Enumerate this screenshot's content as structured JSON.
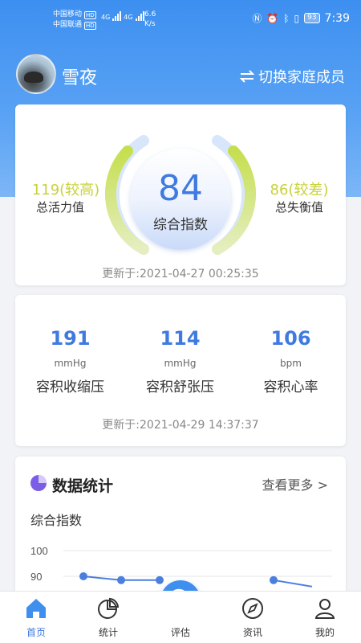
{
  "status_bar": {
    "carrier1": "中国移动",
    "carrier2": "中国联通",
    "hd": "HD",
    "net1": "4G",
    "net2": "4G",
    "speed_value": "6.6",
    "speed_unit": "K/s",
    "battery": "93",
    "time": "7:39"
  },
  "header": {
    "user_name": "雪夜",
    "switch_label": "切换家庭成员"
  },
  "index_card": {
    "score": "84",
    "score_label": "综合指数",
    "left_value": "119(较高)",
    "left_label": "总活力值",
    "right_value": "86(较差)",
    "right_label": "总失衡值",
    "updated": "更新于:2021-04-27 00:25:35"
  },
  "bp_card": {
    "items": [
      {
        "value": "191",
        "unit": "mmHg",
        "label": "容积收缩压"
      },
      {
        "value": "114",
        "unit": "mmHg",
        "label": "容积舒张压"
      },
      {
        "value": "106",
        "unit": "bpm",
        "label": "容积心率"
      }
    ],
    "updated": "更新于:2021-04-29 14:37:37"
  },
  "stats_card": {
    "title": "数据统计",
    "see_more": "查看更多 >",
    "chart_title": "综合指数"
  },
  "chart_data": {
    "type": "line",
    "title": "综合指数",
    "y_ticks": [
      "100",
      "90"
    ],
    "ylim": [
      80,
      100
    ],
    "series": [
      {
        "values": [
          90,
          88.5,
          88.5,
          null,
          null,
          88.5,
          86
        ]
      }
    ],
    "grid": true,
    "colors": {
      "line": "#4a7fde",
      "grid": "#e6e6e6"
    }
  },
  "bottom_nav": {
    "items": [
      {
        "label": "首页",
        "icon": "home-icon",
        "active": true
      },
      {
        "label": "统计",
        "icon": "pie-chart-icon",
        "active": false
      },
      {
        "label": "评估",
        "icon": "pulse-search-icon",
        "active": false
      },
      {
        "label": "资讯",
        "icon": "compass-icon",
        "active": false
      },
      {
        "label": "我的",
        "icon": "user-icon",
        "active": false
      }
    ]
  },
  "colors": {
    "accent": "#3f7ae0",
    "gauge_yellow": "#c8d23a",
    "header_blue": "#3d8ff0"
  }
}
